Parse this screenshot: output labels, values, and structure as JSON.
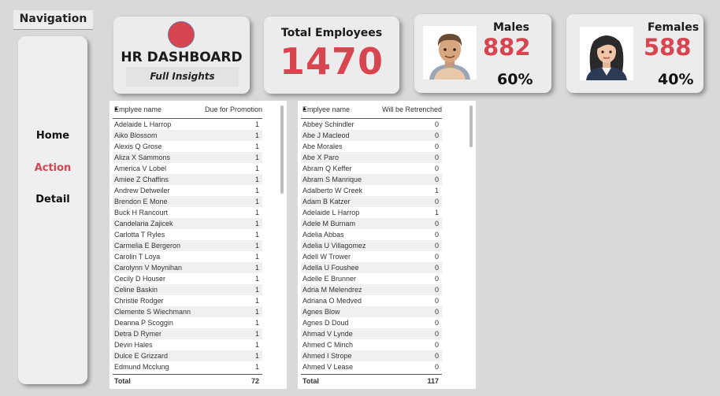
{
  "navigation": {
    "title": "Navigation",
    "items": [
      {
        "label": "Home",
        "color": "#111111"
      },
      {
        "label": "Action",
        "color": "#d64550"
      },
      {
        "label": "Detail",
        "color": "#111111"
      }
    ]
  },
  "header": {
    "dashboard_title": "HR DASHBOARD",
    "dashboard_subtitle": "Full Insights",
    "total_label": "Total Employees",
    "total_value": "1470",
    "males": {
      "label": "Males",
      "value": "882",
      "pct": "60%",
      "icon": "male-avatar-icon"
    },
    "females": {
      "label": "Females",
      "value": "588",
      "pct": "40%",
      "icon": "female-avatar-icon"
    }
  },
  "colors": {
    "accent": "#d64550",
    "background": "#d9d9d9",
    "card": "#ececec"
  },
  "promotion_table": {
    "col_name": "Emplyee name",
    "col_value": "Due for Promotion",
    "rows": [
      [
        "Adelaide L Harrop",
        "1"
      ],
      [
        "Aiko Blossom",
        "1"
      ],
      [
        "Alexis Q Grose",
        "1"
      ],
      [
        "Aliza X Sammons",
        "1"
      ],
      [
        "America V Lobel",
        "1"
      ],
      [
        "Amiee Z Chaffins",
        "1"
      ],
      [
        "Andrew Detweiler",
        "1"
      ],
      [
        "Brendon E Mone",
        "1"
      ],
      [
        "Buck H Rancourt",
        "1"
      ],
      [
        "Candelaria Zajicek",
        "1"
      ],
      [
        "Carlotta T Ryles",
        "1"
      ],
      [
        "Carmelia E Bergeron",
        "1"
      ],
      [
        "Carolin T Loya",
        "1"
      ],
      [
        "Carolynn V Moynihan",
        "1"
      ],
      [
        "Cecily D Houser",
        "1"
      ],
      [
        "Celine Baskin",
        "1"
      ],
      [
        "Christie Rodger",
        "1"
      ],
      [
        "Clemente S Wiechmann",
        "1"
      ],
      [
        "Deanna P Scoggin",
        "1"
      ],
      [
        "Detra D Rymer",
        "1"
      ],
      [
        "Devin Hales",
        "1"
      ],
      [
        "Dulce E Grizzard",
        "1"
      ],
      [
        "Edmund Mcclung",
        "1"
      ]
    ],
    "total_label": "Total",
    "total_value": "72"
  },
  "retrench_table": {
    "col_name": "Emplyee name",
    "col_value": "Will be Retrenched",
    "rows": [
      [
        "Abbey Schindler",
        "0"
      ],
      [
        "Abe J Macleod",
        "0"
      ],
      [
        "Abe Morales",
        "0"
      ],
      [
        "Abe X Paro",
        "0"
      ],
      [
        "Abram Q Keffer",
        "0"
      ],
      [
        "Abram S Manrique",
        "0"
      ],
      [
        "Adalberto W Creek",
        "1"
      ],
      [
        "Adam B Katzer",
        "0"
      ],
      [
        "Adelaide L Harrop",
        "1"
      ],
      [
        "Adele M Burnam",
        "0"
      ],
      [
        "Adelia Abbas",
        "0"
      ],
      [
        "Adelia U Villagomez",
        "0"
      ],
      [
        "Adell W Trower",
        "0"
      ],
      [
        "Adella U Foushee",
        "0"
      ],
      [
        "Adelle E Brunner",
        "0"
      ],
      [
        "Adria M Melendrez",
        "0"
      ],
      [
        "Adriana O Medved",
        "0"
      ],
      [
        "Agnes Blow",
        "0"
      ],
      [
        "Agnes D Doud",
        "0"
      ],
      [
        "Ahmad V Lynde",
        "0"
      ],
      [
        "Ahmed C Minch",
        "0"
      ],
      [
        "Ahmed I Strope",
        "0"
      ],
      [
        "Ahmed V Lease",
        "0"
      ]
    ],
    "total_label": "Total",
    "total_value": "117"
  }
}
